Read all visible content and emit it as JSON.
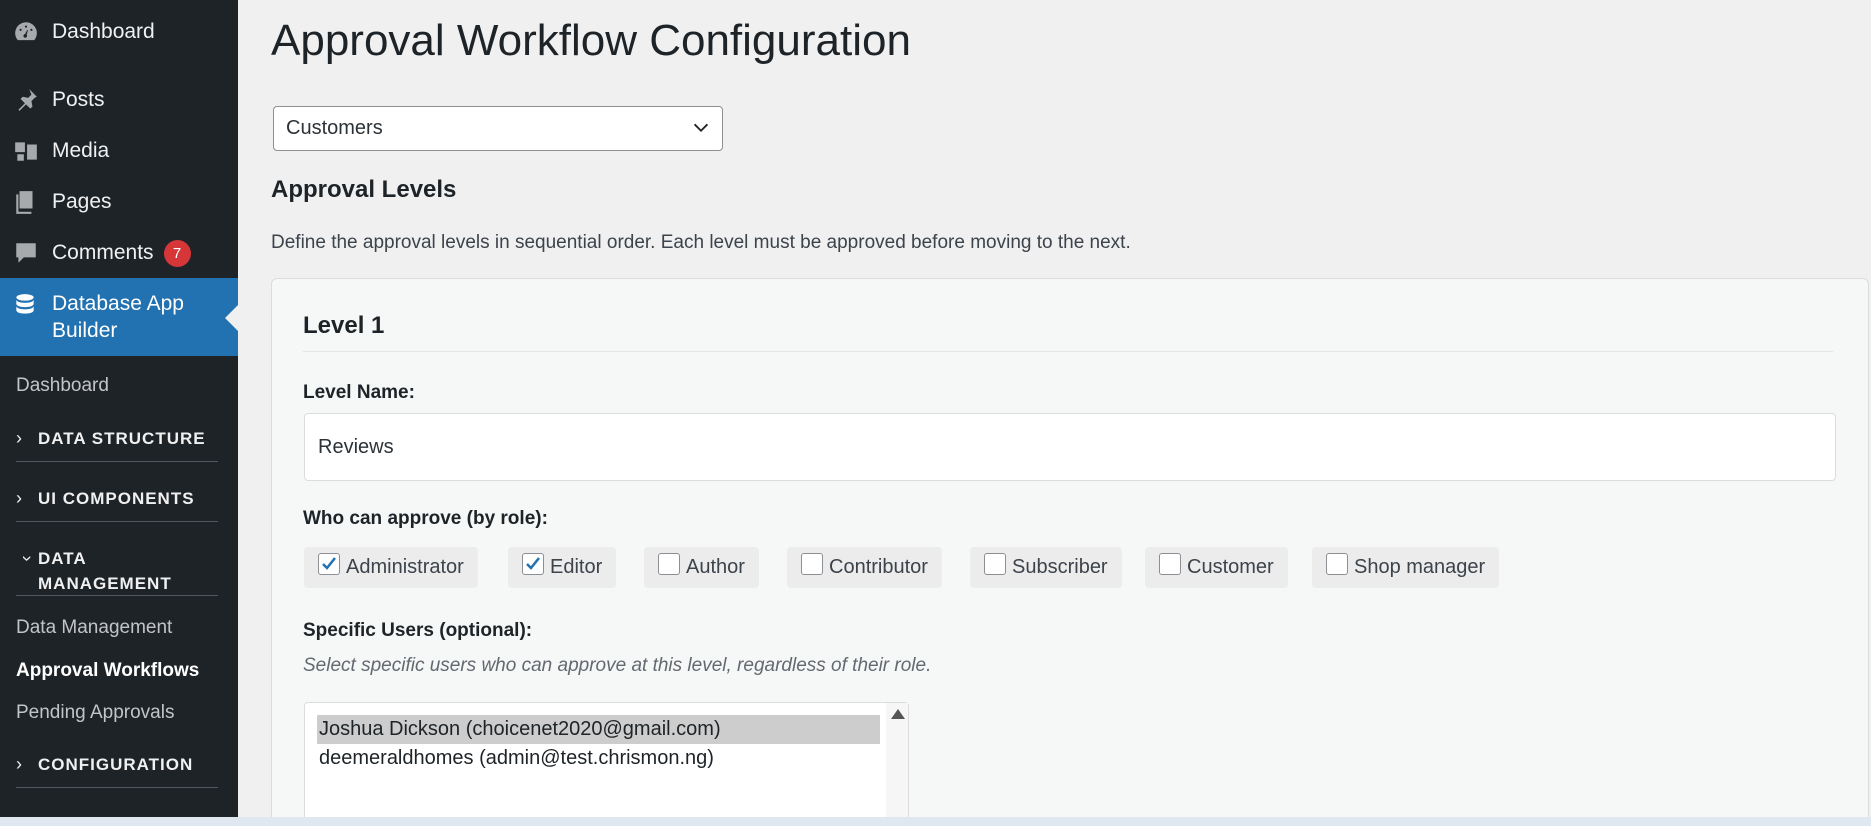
{
  "sidebar": {
    "menu": [
      {
        "label": "Dashboard",
        "icon": "dashboard-icon"
      },
      {
        "label": "Posts",
        "icon": "pin-icon"
      },
      {
        "label": "Media",
        "icon": "media-icon"
      },
      {
        "label": "Pages",
        "icon": "pages-icon"
      },
      {
        "label": "Comments",
        "icon": "comments-icon",
        "badge": "7"
      }
    ],
    "active": {
      "label": "Database App Builder",
      "icon": "database-icon"
    },
    "submenu": {
      "dashboard": "Dashboard",
      "groups": [
        {
          "label": "DATA STRUCTURE",
          "expanded": false
        },
        {
          "label": "UI COMPONENTS",
          "expanded": false
        },
        {
          "label": "DATA MANAGEMENT",
          "expanded": true
        },
        {
          "label": "CONFIGURATION",
          "expanded": false
        }
      ],
      "items": [
        "Data Management",
        "Approval Workflows",
        "Pending Approvals"
      ],
      "current": "Approval Workflows"
    },
    "colors": {
      "background": "#1d2327",
      "active": "#2271b1",
      "badge": "#d63638"
    }
  },
  "main": {
    "title": "Approval Workflow Configuration",
    "table_select": {
      "value": "Customers"
    },
    "section_title": "Approval Levels",
    "description": "Define the approval levels in sequential order. Each level must be approved before moving to the next.",
    "level": {
      "title": "Level 1",
      "name_label": "Level Name:",
      "name_value": "Reviews",
      "roles_label": "Who can approve (by role):",
      "roles": [
        {
          "label": "Administrator",
          "checked": true
        },
        {
          "label": "Editor",
          "checked": true
        },
        {
          "label": "Author",
          "checked": false
        },
        {
          "label": "Contributor",
          "checked": false
        },
        {
          "label": "Subscriber",
          "checked": false
        },
        {
          "label": "Customer",
          "checked": false
        },
        {
          "label": "Shop manager",
          "checked": false
        }
      ],
      "users_label": "Specific Users (optional):",
      "users_hint": "Select specific users who can approve at this level, regardless of their role.",
      "users": [
        {
          "label": "Joshua Dickson (choicenet2020@gmail.com)",
          "selected": true
        },
        {
          "label": "deemeraldhomes (admin@test.chrismon.ng)",
          "selected": false
        }
      ]
    }
  }
}
